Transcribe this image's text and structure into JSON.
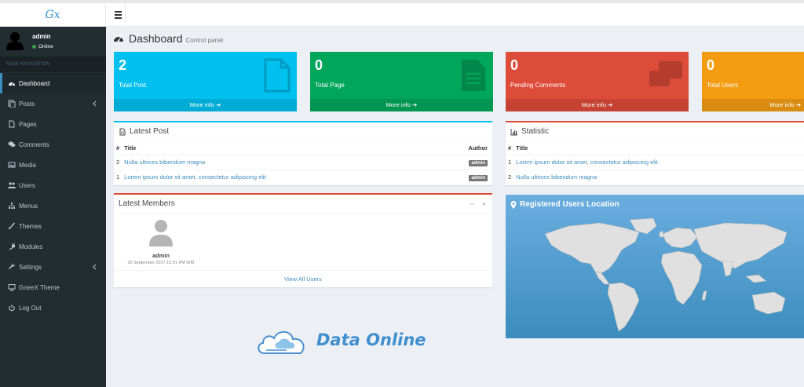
{
  "brand": {
    "logo_text": "Gx"
  },
  "user": {
    "name": "admin",
    "status": "Online"
  },
  "sidebar": {
    "header": "MAIN NAVIGATION",
    "items": [
      {
        "label": "Dashboard",
        "icon": "dashboard-icon",
        "active": true
      },
      {
        "label": "Posts",
        "icon": "copy-icon",
        "has_children": true
      },
      {
        "label": "Pages",
        "icon": "file-icon"
      },
      {
        "label": "Comments",
        "icon": "comments-icon"
      },
      {
        "label": "Media",
        "icon": "image-icon"
      },
      {
        "label": "Users",
        "icon": "users-icon"
      },
      {
        "label": "Menus",
        "icon": "sitemap-icon"
      },
      {
        "label": "Themes",
        "icon": "brush-icon"
      },
      {
        "label": "Modules",
        "icon": "plug-icon"
      },
      {
        "label": "Settings",
        "icon": "wrench-icon",
        "has_children": true
      },
      {
        "label": "GneeX Theme",
        "icon": "desktop-icon"
      },
      {
        "label": "Log Out",
        "icon": "power-icon"
      }
    ]
  },
  "page": {
    "title": "Dashboard",
    "subtitle": "Control panel"
  },
  "stats": [
    {
      "value": "2",
      "label": "Total Post",
      "more": "More info",
      "color": "#00c0ef",
      "icon": "file-icon"
    },
    {
      "value": "0",
      "label": "Total Page",
      "more": "More info",
      "color": "#00a65a",
      "icon": "file-text-icon"
    },
    {
      "value": "0",
      "label": "Pending Comments",
      "more": "More info",
      "color": "#dd4b39",
      "icon": "comments-icon"
    },
    {
      "value": "0",
      "label": "Total Users",
      "more": "More info",
      "color": "#f39c12",
      "icon": "users-icon"
    }
  ],
  "latest_post": {
    "title": "Latest Post",
    "columns": [
      "#",
      "Title",
      "Author"
    ],
    "rows": [
      {
        "num": "2",
        "title": "Nulla ultrices bibendum magna",
        "author": "admin"
      },
      {
        "num": "1",
        "title": "Lorem ipsum dolor sit amet, consectetur adipiscing elit",
        "author": "admin"
      }
    ]
  },
  "statistic": {
    "title": "Statistic",
    "columns": [
      "#",
      "Title"
    ],
    "rows": [
      {
        "num": "1",
        "title": "Lorem ipsum dolor sit amet, consectetur adipiscing elit"
      },
      {
        "num": "2",
        "title": "Nulla ultrices bibendum magna"
      }
    ]
  },
  "latest_members": {
    "title": "Latest Members",
    "tool_minimize": "−",
    "tool_close": "×",
    "members": [
      {
        "name": "admin",
        "date": "20 September 2017 15:51 PM WIB"
      }
    ],
    "footer": "View All Users"
  },
  "map": {
    "title": "Registered Users Location"
  },
  "watermark": {
    "text": "Data Online"
  },
  "colors": {
    "sidebar": "#222d32",
    "accent": "#3c8dbc",
    "content_bg": "#ecf0f5"
  }
}
